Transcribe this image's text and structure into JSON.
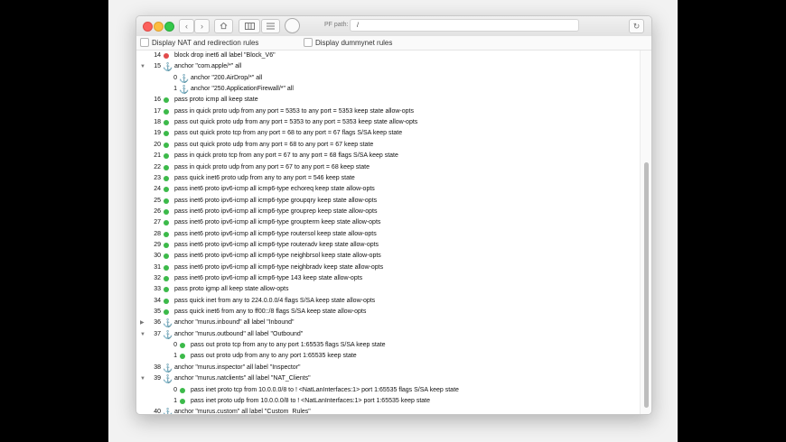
{
  "toolbar": {
    "back_icon": "‹",
    "forward_icon": "›",
    "pf_path_label": "PF path:",
    "pf_path_value": "/",
    "reload_icon": "↻"
  },
  "options": {
    "nat_label": "Display NAT and redirection rules",
    "dummynet_label": "Display dummynet rules"
  },
  "rules": [
    {
      "depth": 0,
      "num": "14",
      "icon": "dot-red",
      "text": "block drop inet6 all label \"Block_V6\""
    },
    {
      "depth": 0,
      "num": "15",
      "icon": "anchor",
      "expander": "open",
      "text": "anchor \"com.apple/*\" all"
    },
    {
      "depth": 1,
      "num": "0",
      "icon": "anchor",
      "text": "anchor \"200.AirDrop/*\" all"
    },
    {
      "depth": 1,
      "num": "1",
      "icon": "anchor",
      "text": "anchor \"250.ApplicationFirewall/*\" all"
    },
    {
      "depth": 0,
      "num": "16",
      "icon": "dot-green",
      "text": "pass proto icmp all keep state"
    },
    {
      "depth": 0,
      "num": "17",
      "icon": "dot-green",
      "text": "pass in quick proto udp from any port = 5353 to any port = 5353 keep state allow-opts"
    },
    {
      "depth": 0,
      "num": "18",
      "icon": "dot-green",
      "text": "pass out quick proto udp from any port = 5353 to any port = 5353 keep state allow-opts"
    },
    {
      "depth": 0,
      "num": "19",
      "icon": "dot-green",
      "text": "pass out quick proto tcp from any port = 68 to any port = 67 flags S/SA keep state"
    },
    {
      "depth": 0,
      "num": "20",
      "icon": "dot-green",
      "text": "pass out quick proto udp from any port = 68 to any port = 67 keep state"
    },
    {
      "depth": 0,
      "num": "21",
      "icon": "dot-green",
      "text": "pass in quick proto tcp from any port = 67 to any port = 68 flags S/SA keep state"
    },
    {
      "depth": 0,
      "num": "22",
      "icon": "dot-green",
      "text": "pass in quick proto udp from any port = 67 to any port = 68 keep state"
    },
    {
      "depth": 0,
      "num": "23",
      "icon": "dot-green",
      "text": "pass quick inet6 proto udp from any to any port = 546 keep state"
    },
    {
      "depth": 0,
      "num": "24",
      "icon": "dot-green",
      "text": "pass inet6 proto ipv6-icmp all icmp6-type echoreq keep state allow-opts"
    },
    {
      "depth": 0,
      "num": "25",
      "icon": "dot-green",
      "text": "pass inet6 proto ipv6-icmp all icmp6-type groupqry keep state allow-opts"
    },
    {
      "depth": 0,
      "num": "26",
      "icon": "dot-green",
      "text": "pass inet6 proto ipv6-icmp all icmp6-type grouprep keep state allow-opts"
    },
    {
      "depth": 0,
      "num": "27",
      "icon": "dot-green",
      "text": "pass inet6 proto ipv6-icmp all icmp6-type groupterm keep state allow-opts"
    },
    {
      "depth": 0,
      "num": "28",
      "icon": "dot-green",
      "text": "pass inet6 proto ipv6-icmp all icmp6-type routersol keep state allow-opts"
    },
    {
      "depth": 0,
      "num": "29",
      "icon": "dot-green",
      "text": "pass inet6 proto ipv6-icmp all icmp6-type routeradv keep state allow-opts"
    },
    {
      "depth": 0,
      "num": "30",
      "icon": "dot-green",
      "text": "pass inet6 proto ipv6-icmp all icmp6-type neighbrsol keep state allow-opts"
    },
    {
      "depth": 0,
      "num": "31",
      "icon": "dot-green",
      "text": "pass inet6 proto ipv6-icmp all icmp6-type neighbradv keep state allow-opts"
    },
    {
      "depth": 0,
      "num": "32",
      "icon": "dot-green",
      "text": "pass inet6 proto ipv6-icmp all icmp6-type 143 keep state allow-opts"
    },
    {
      "depth": 0,
      "num": "33",
      "icon": "dot-green",
      "text": "pass proto igmp all keep state allow-opts"
    },
    {
      "depth": 0,
      "num": "34",
      "icon": "dot-green",
      "text": "pass quick inet from any to 224.0.0.0/4 flags S/SA keep state allow-opts"
    },
    {
      "depth": 0,
      "num": "35",
      "icon": "dot-green",
      "text": "pass quick inet6 from any to ff00::/8 flags S/SA keep state allow-opts"
    },
    {
      "depth": 0,
      "num": "36",
      "icon": "anchor",
      "expander": "closed",
      "text": "anchor \"murus.inbound\" all label \"Inbound\""
    },
    {
      "depth": 0,
      "num": "37",
      "icon": "anchor",
      "expander": "open",
      "text": "anchor \"murus.outbound\" all label \"Outbound\""
    },
    {
      "depth": 1,
      "num": "0",
      "icon": "dot-green",
      "text": "pass out proto tcp from any to any port 1:65535 flags S/SA keep state"
    },
    {
      "depth": 1,
      "num": "1",
      "icon": "dot-green",
      "text": "pass out proto udp from any to any port 1:65535 keep state"
    },
    {
      "depth": 0,
      "num": "38",
      "icon": "anchor",
      "text": "anchor \"murus.inspector\" all label \"Inspector\""
    },
    {
      "depth": 0,
      "num": "39",
      "icon": "anchor",
      "expander": "open",
      "text": "anchor \"murus.natclients\" all label \"NAT_Clients\""
    },
    {
      "depth": 1,
      "num": "0",
      "icon": "dot-green",
      "text": "pass inet proto tcp from 10.0.0.0/8 to ! <NatLanInterfaces:1> port 1:65535 flags S/SA keep state"
    },
    {
      "depth": 1,
      "num": "1",
      "icon": "dot-green",
      "text": "pass inet proto udp from 10.0.0.0/8 to ! <NatLanInterfaces:1> port 1:65535 keep state"
    },
    {
      "depth": 0,
      "num": "40",
      "icon": "anchor",
      "text": "anchor \"murus.custom\" all label \"Custom_Rules\""
    }
  ],
  "icons": {
    "anchor": "⚓",
    "expander_open": "▼",
    "expander_closed": "▶"
  }
}
